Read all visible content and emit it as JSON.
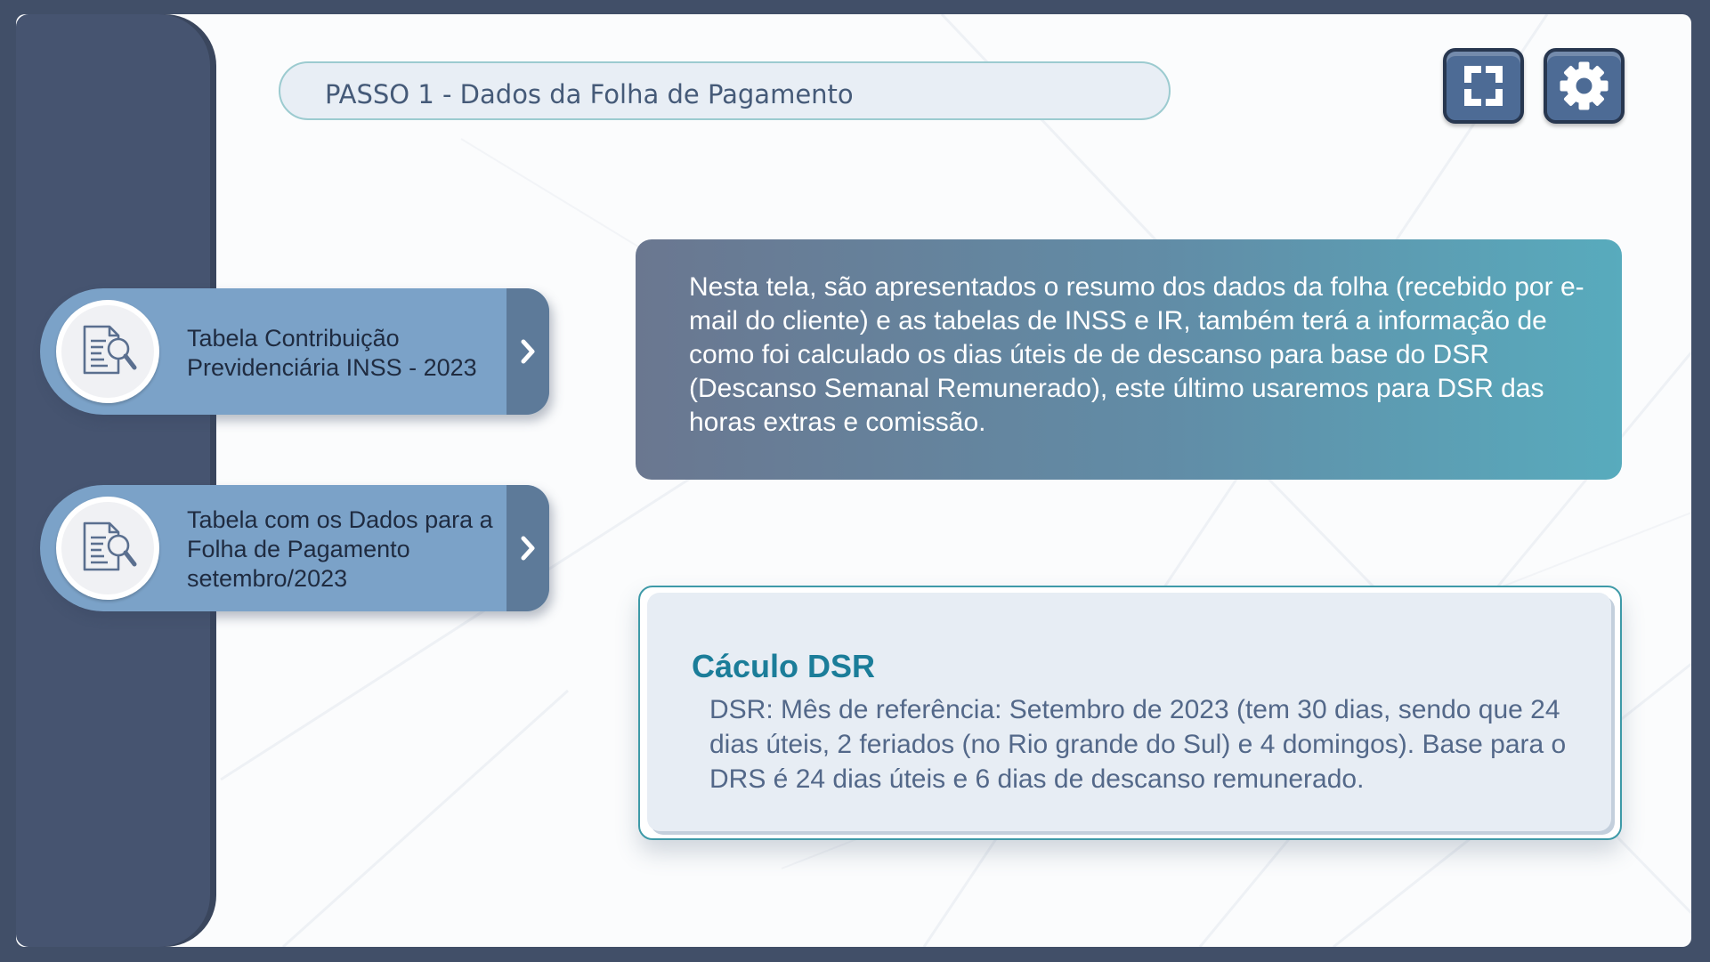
{
  "header": {
    "step_title": "PASSO 1 - Dados da Folha de Pagamento"
  },
  "toolbar": {
    "fullscreen_icon": "fullscreen-icon",
    "settings_icon": "gear-icon"
  },
  "nav": {
    "items": [
      {
        "label": "Tabela Contribuição Previdenciária INSS - 2023",
        "icon": "document-search-icon",
        "arrow": "chevron-right-icon"
      },
      {
        "label": "Tabela com os Dados para a Folha de Pagamento setembro/2023",
        "icon": "document-search-icon",
        "arrow": "chevron-right-icon"
      }
    ]
  },
  "info": {
    "text": "Nesta tela, são apresentados o resumo dos dados da folha (recebido por e-mail do cliente) e as tabelas de INSS e IR, também terá a informação de como foi calculado os dias úteis de de descanso para base do DSR (Descanso Semanal Remunerado), este último usaremos para DSR das horas extras e comissão."
  },
  "dsr": {
    "title": "Cáculo DSR",
    "text": "DSR: Mês de referência: Setembro de 2023 (tem 30 dias, sendo que 24 dias úteis, 2 feriados (no Rio grande do Sul) e 4 domingos). Base para o DRS é 24 dias úteis e 6 dias de descanso remunerado."
  },
  "colors": {
    "frame": "#414f68",
    "sidebar": "#465470",
    "nav_card": "#7ba2c8",
    "nav_tab": "#5d7a99",
    "accent_title": "#1b7d99"
  }
}
